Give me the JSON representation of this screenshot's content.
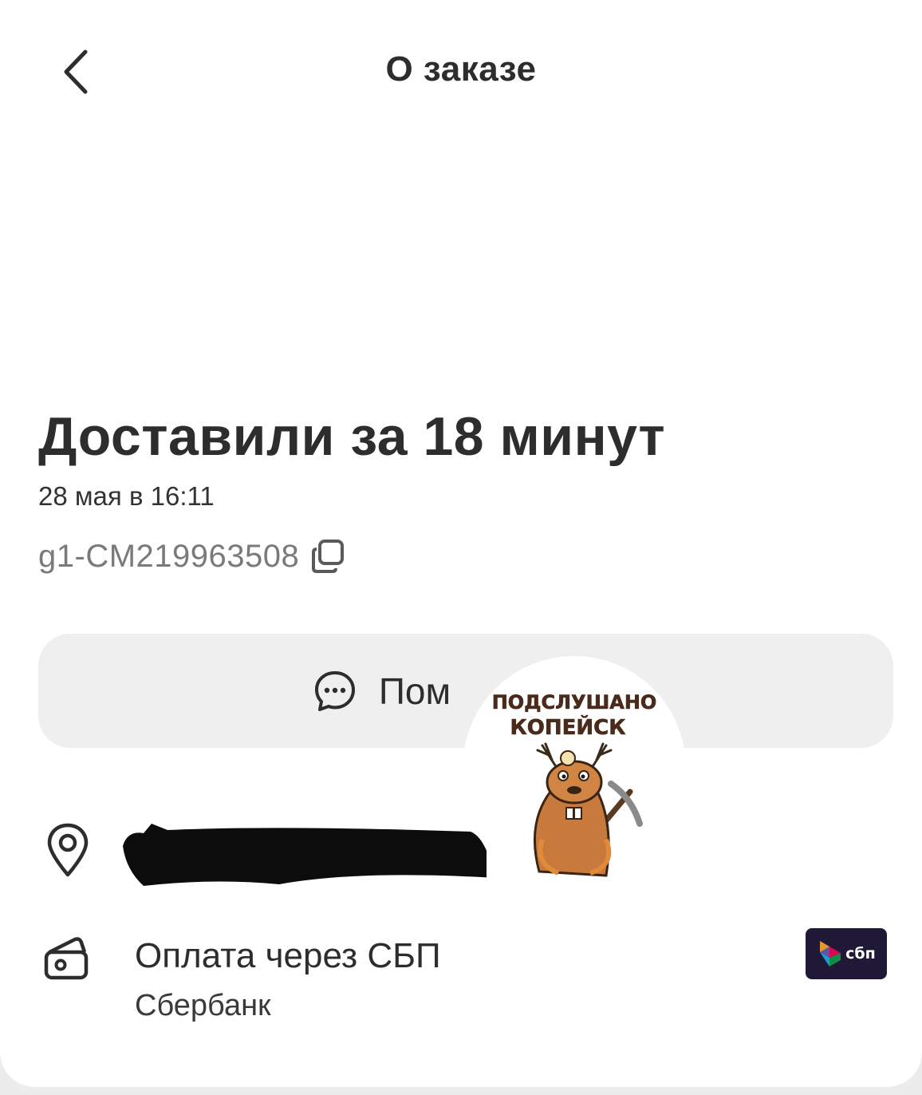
{
  "header": {
    "title": "О заказе"
  },
  "order": {
    "status_title": "Доставили за 18 минут",
    "date": "28 мая в 16:11",
    "id": "g1-CM219963508"
  },
  "help": {
    "label": "Пом"
  },
  "watermark": {
    "line1": "ПОДСЛУШАНО",
    "line2": "КОПЕЙСК"
  },
  "payment": {
    "title": "Оплата через СБП",
    "bank": "Сбербанк",
    "badge_label": "сбп"
  },
  "colors": {
    "text": "#2d2d2d",
    "muted": "#7a7a7a",
    "button_bg": "#efefef",
    "sbp_badge": "#1f1837",
    "outer_bg": "#ececec"
  },
  "icons": {
    "back": "chevron-left-icon",
    "copy": "copy-icon",
    "chat": "chat-bubble-icon",
    "location": "location-pin-icon",
    "wallet": "wallet-icon",
    "sbp": "sbp-logo-icon"
  }
}
